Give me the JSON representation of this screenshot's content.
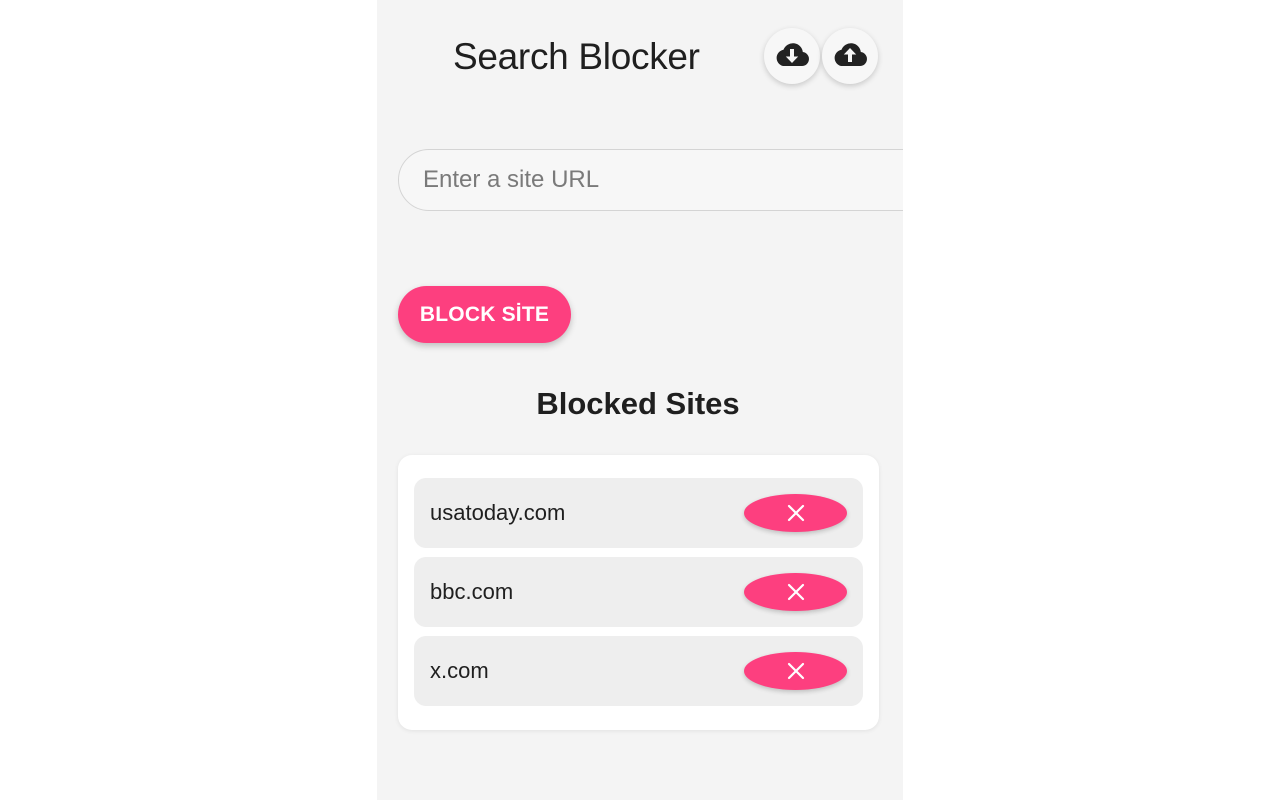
{
  "header": {
    "title": "Search Blocker",
    "download_icon": "cloud-download-icon",
    "upload_icon": "cloud-upload-icon"
  },
  "form": {
    "url_placeholder": "Enter a site URL",
    "url_value": "",
    "block_button_label": "BLOCK SİTE"
  },
  "blocked": {
    "title": "Blocked Sites",
    "sites": [
      {
        "label": "usatoday.com",
        "remove_icon": "close-icon"
      },
      {
        "label": "bbc.com",
        "remove_icon": "close-icon"
      },
      {
        "label": "x.com",
        "remove_icon": "close-icon"
      }
    ]
  },
  "colors": {
    "accent": "#fd3f7f",
    "panel_background": "#f4f4f4",
    "row_background": "#eeeeee",
    "text": "#1f1f1f"
  }
}
